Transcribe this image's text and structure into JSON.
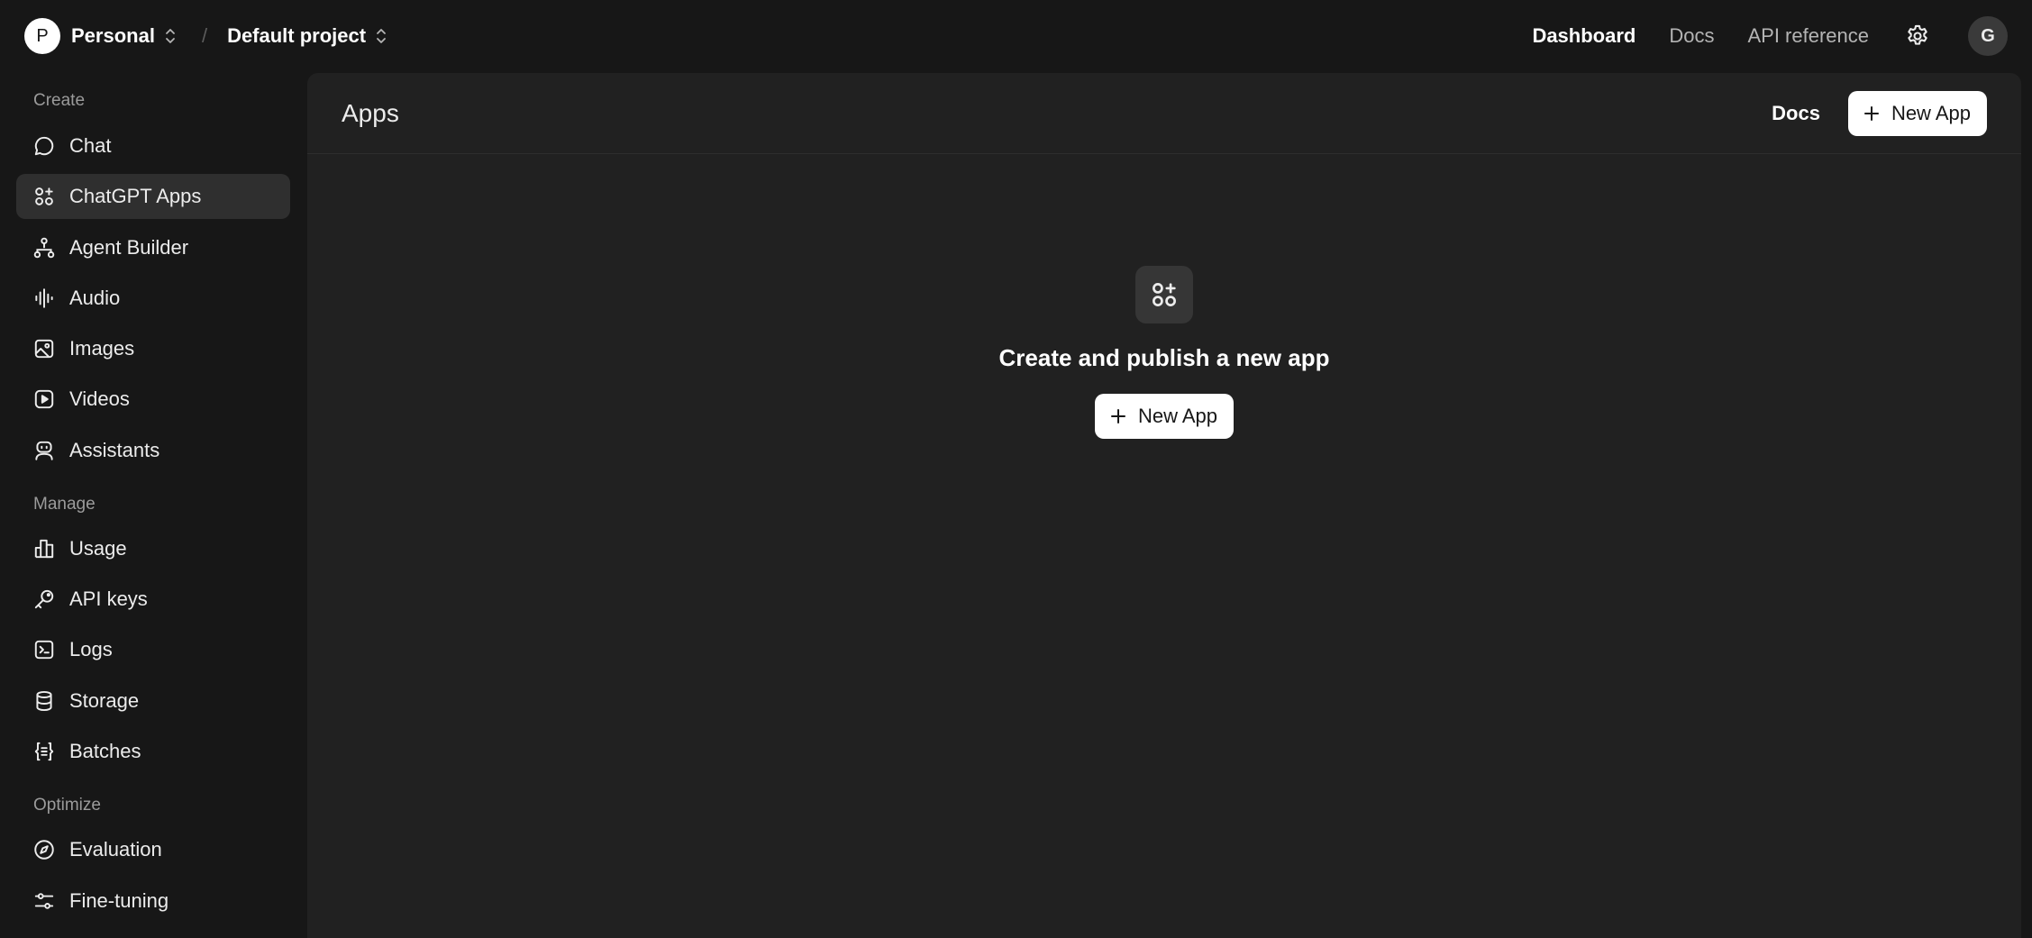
{
  "topbar": {
    "org_initial": "P",
    "org_name": "Personal",
    "separator": "/",
    "project_name": "Default project",
    "links": [
      "Dashboard",
      "Docs",
      "API reference"
    ],
    "active_link": "Dashboard",
    "user_initial": "G"
  },
  "sidebar": {
    "sections": [
      {
        "label": "Create",
        "items": [
          {
            "label": "Chat",
            "icon": "chat-bubble-icon"
          },
          {
            "label": "ChatGPT Apps",
            "icon": "apps-grid-icon",
            "active": true
          },
          {
            "label": "Agent Builder",
            "icon": "agent-tree-icon"
          },
          {
            "label": "Audio",
            "icon": "audio-wave-icon"
          },
          {
            "label": "Images",
            "icon": "image-icon"
          },
          {
            "label": "Videos",
            "icon": "video-play-icon"
          },
          {
            "label": "Assistants",
            "icon": "robot-icon"
          }
        ]
      },
      {
        "label": "Manage",
        "items": [
          {
            "label": "Usage",
            "icon": "bar-chart-icon"
          },
          {
            "label": "API keys",
            "icon": "key-icon"
          },
          {
            "label": "Logs",
            "icon": "terminal-icon"
          },
          {
            "label": "Storage",
            "icon": "database-icon"
          },
          {
            "label": "Batches",
            "icon": "braces-list-icon"
          }
        ]
      },
      {
        "label": "Optimize",
        "items": [
          {
            "label": "Evaluation",
            "icon": "compass-icon"
          },
          {
            "label": "Fine-tuning",
            "icon": "sliders-icon"
          }
        ]
      }
    ]
  },
  "main": {
    "title": "Apps",
    "header_docs": "Docs",
    "new_app_label": "New App",
    "empty_title": "Create and publish a new app",
    "empty_button_label": "New App"
  }
}
